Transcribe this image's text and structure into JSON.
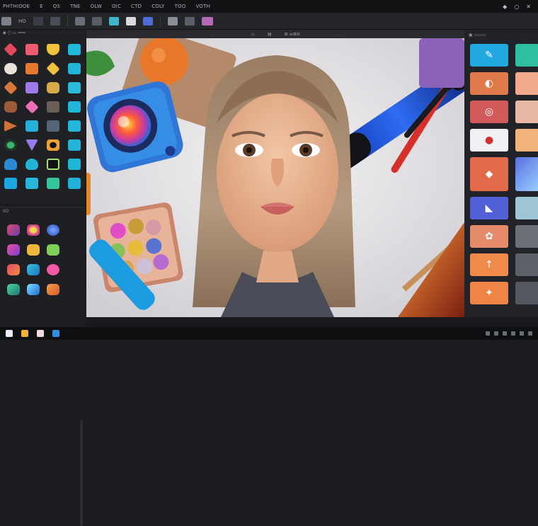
{
  "menubar": {
    "items": [
      "PHTHIOOE",
      "E",
      "QS",
      "TNE",
      "OLW",
      "OIC",
      "CTD",
      "COLY",
      "TOO",
      "VOTH"
    ],
    "window_controls": [
      "◆",
      "○",
      "✕"
    ]
  },
  "toolbar": {
    "label": "HO"
  },
  "canvas_header": {
    "items": [
      "▭",
      "▤",
      "⊞ ≡⊞⊟"
    ]
  },
  "left_panel": {
    "header": "◆  ○   ▭  ═══"
  },
  "left_panel2": {
    "header": "IIO"
  },
  "right_panel": {
    "header": "▣ ▭▭▭"
  },
  "colors": {
    "app_bg": "#1b1c20",
    "panel_bg": "#202125",
    "accent_blue": "#1c9be0",
    "accent_orange": "#e07a4a"
  }
}
